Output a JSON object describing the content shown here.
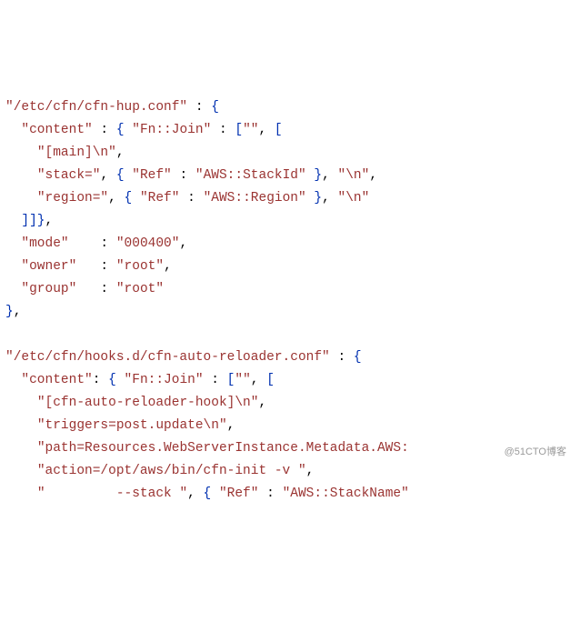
{
  "lines": [
    [
      [
        "s",
        "\"/etc/cfn/cfn-hup.conf\""
      ],
      [
        "p",
        " : "
      ],
      [
        "br",
        "{"
      ]
    ],
    [
      [
        "p",
        "  "
      ],
      [
        "s",
        "\"content\""
      ],
      [
        "p",
        " : "
      ],
      [
        "br",
        "{"
      ],
      [
        "p",
        " "
      ],
      [
        "s",
        "\"Fn::Join\""
      ],
      [
        "p",
        " : "
      ],
      [
        "br",
        "["
      ],
      [
        "s",
        "\"\""
      ],
      [
        "p",
        ", "
      ],
      [
        "br",
        "["
      ]
    ],
    [
      [
        "p",
        "    "
      ],
      [
        "s",
        "\"[main]\\n\""
      ],
      [
        "p",
        ","
      ]
    ],
    [
      [
        "p",
        "    "
      ],
      [
        "s",
        "\"stack=\""
      ],
      [
        "p",
        ", "
      ],
      [
        "br",
        "{"
      ],
      [
        "p",
        " "
      ],
      [
        "s",
        "\"Ref\""
      ],
      [
        "p",
        " : "
      ],
      [
        "s",
        "\"AWS::StackId\""
      ],
      [
        "p",
        " "
      ],
      [
        "br",
        "}"
      ],
      [
        "p",
        ", "
      ],
      [
        "s",
        "\"\\n\""
      ],
      [
        "p",
        ","
      ]
    ],
    [
      [
        "p",
        "    "
      ],
      [
        "s",
        "\"region=\""
      ],
      [
        "p",
        ", "
      ],
      [
        "br",
        "{"
      ],
      [
        "p",
        " "
      ],
      [
        "s",
        "\"Ref\""
      ],
      [
        "p",
        " : "
      ],
      [
        "s",
        "\"AWS::Region\""
      ],
      [
        "p",
        " "
      ],
      [
        "br",
        "}"
      ],
      [
        "p",
        ", "
      ],
      [
        "s",
        "\"\\n\""
      ]
    ],
    [
      [
        "p",
        "  "
      ],
      [
        "br",
        "]]}"
      ],
      [
        "p",
        ","
      ]
    ],
    [
      [
        "p",
        "  "
      ],
      [
        "s",
        "\"mode\""
      ],
      [
        "p",
        "    : "
      ],
      [
        "s",
        "\"000400\""
      ],
      [
        "p",
        ","
      ]
    ],
    [
      [
        "p",
        "  "
      ],
      [
        "s",
        "\"owner\""
      ],
      [
        "p",
        "   : "
      ],
      [
        "s",
        "\"root\""
      ],
      [
        "p",
        ","
      ]
    ],
    [
      [
        "p",
        "  "
      ],
      [
        "s",
        "\"group\""
      ],
      [
        "p",
        "   : "
      ],
      [
        "s",
        "\"root\""
      ]
    ],
    [
      [
        "br",
        "}"
      ],
      [
        "p",
        ","
      ]
    ],
    [
      [
        "p",
        " "
      ]
    ],
    [
      [
        "s",
        "\"/etc/cfn/hooks.d/cfn-auto-reloader.conf\""
      ],
      [
        "p",
        " : "
      ],
      [
        "br",
        "{"
      ]
    ],
    [
      [
        "p",
        "  "
      ],
      [
        "s",
        "\"content\""
      ],
      [
        "p",
        ": "
      ],
      [
        "br",
        "{"
      ],
      [
        "p",
        " "
      ],
      [
        "s",
        "\"Fn::Join\""
      ],
      [
        "p",
        " : "
      ],
      [
        "br",
        "["
      ],
      [
        "s",
        "\"\""
      ],
      [
        "p",
        ", "
      ],
      [
        "br",
        "["
      ]
    ],
    [
      [
        "p",
        "    "
      ],
      [
        "s",
        "\"[cfn-auto-reloader-hook]\\n\""
      ],
      [
        "p",
        ","
      ]
    ],
    [
      [
        "p",
        "    "
      ],
      [
        "s",
        "\"triggers=post.update\\n\""
      ],
      [
        "p",
        ","
      ]
    ],
    [
      [
        "p",
        "    "
      ],
      [
        "s",
        "\"path=Resources.WebServerInstance.Metadata.AWS:"
      ]
    ],
    [
      [
        "p",
        "    "
      ],
      [
        "s",
        "\"action=/opt/aws/bin/cfn-init -v \""
      ],
      [
        "p",
        ","
      ]
    ],
    [
      [
        "p",
        "    "
      ],
      [
        "s",
        "\"         --stack \""
      ],
      [
        "p",
        ", "
      ],
      [
        "br",
        "{"
      ],
      [
        "p",
        " "
      ],
      [
        "s",
        "\"Ref\""
      ],
      [
        "p",
        " : "
      ],
      [
        "s",
        "\"AWS::StackName\""
      ]
    ]
  ],
  "watermark": "@51CTO博客"
}
